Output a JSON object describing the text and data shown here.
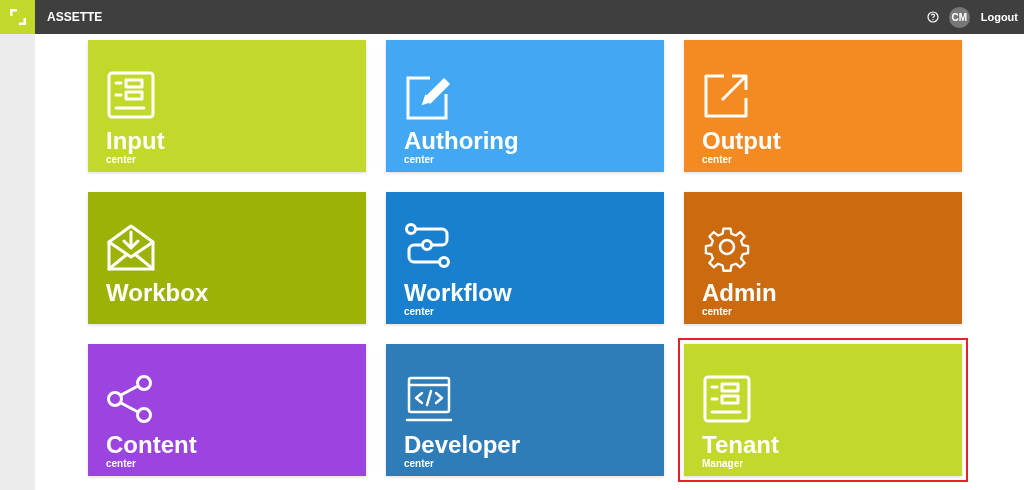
{
  "header": {
    "brand": "ASSETTE",
    "avatar": "CM",
    "logout": "Logout"
  },
  "tiles": [
    {
      "title": "Input",
      "subtitle": "center",
      "color": "#c2d82a",
      "highlighted": false
    },
    {
      "title": "Authoring",
      "subtitle": "center",
      "color": "#42a8f4",
      "highlighted": false
    },
    {
      "title": "Output",
      "subtitle": "center",
      "color": "#f38a22",
      "highlighted": false
    },
    {
      "title": "Workbox",
      "color": "#9db206",
      "highlighted": false
    },
    {
      "title": "Workflow",
      "subtitle": "center",
      "color": "#1880cf",
      "highlighted": false
    },
    {
      "title": "Admin",
      "subtitle": "center",
      "color": "#cc6a10",
      "highlighted": false
    },
    {
      "title": "Content",
      "subtitle": "center",
      "color": "#9b44df",
      "highlighted": false
    },
    {
      "title": "Developer",
      "subtitle": "center",
      "color": "#2e7cb8",
      "highlighted": false
    },
    {
      "title": "Tenant",
      "subtitle": "Manager",
      "color": "#c2d82a",
      "highlighted": true
    }
  ]
}
